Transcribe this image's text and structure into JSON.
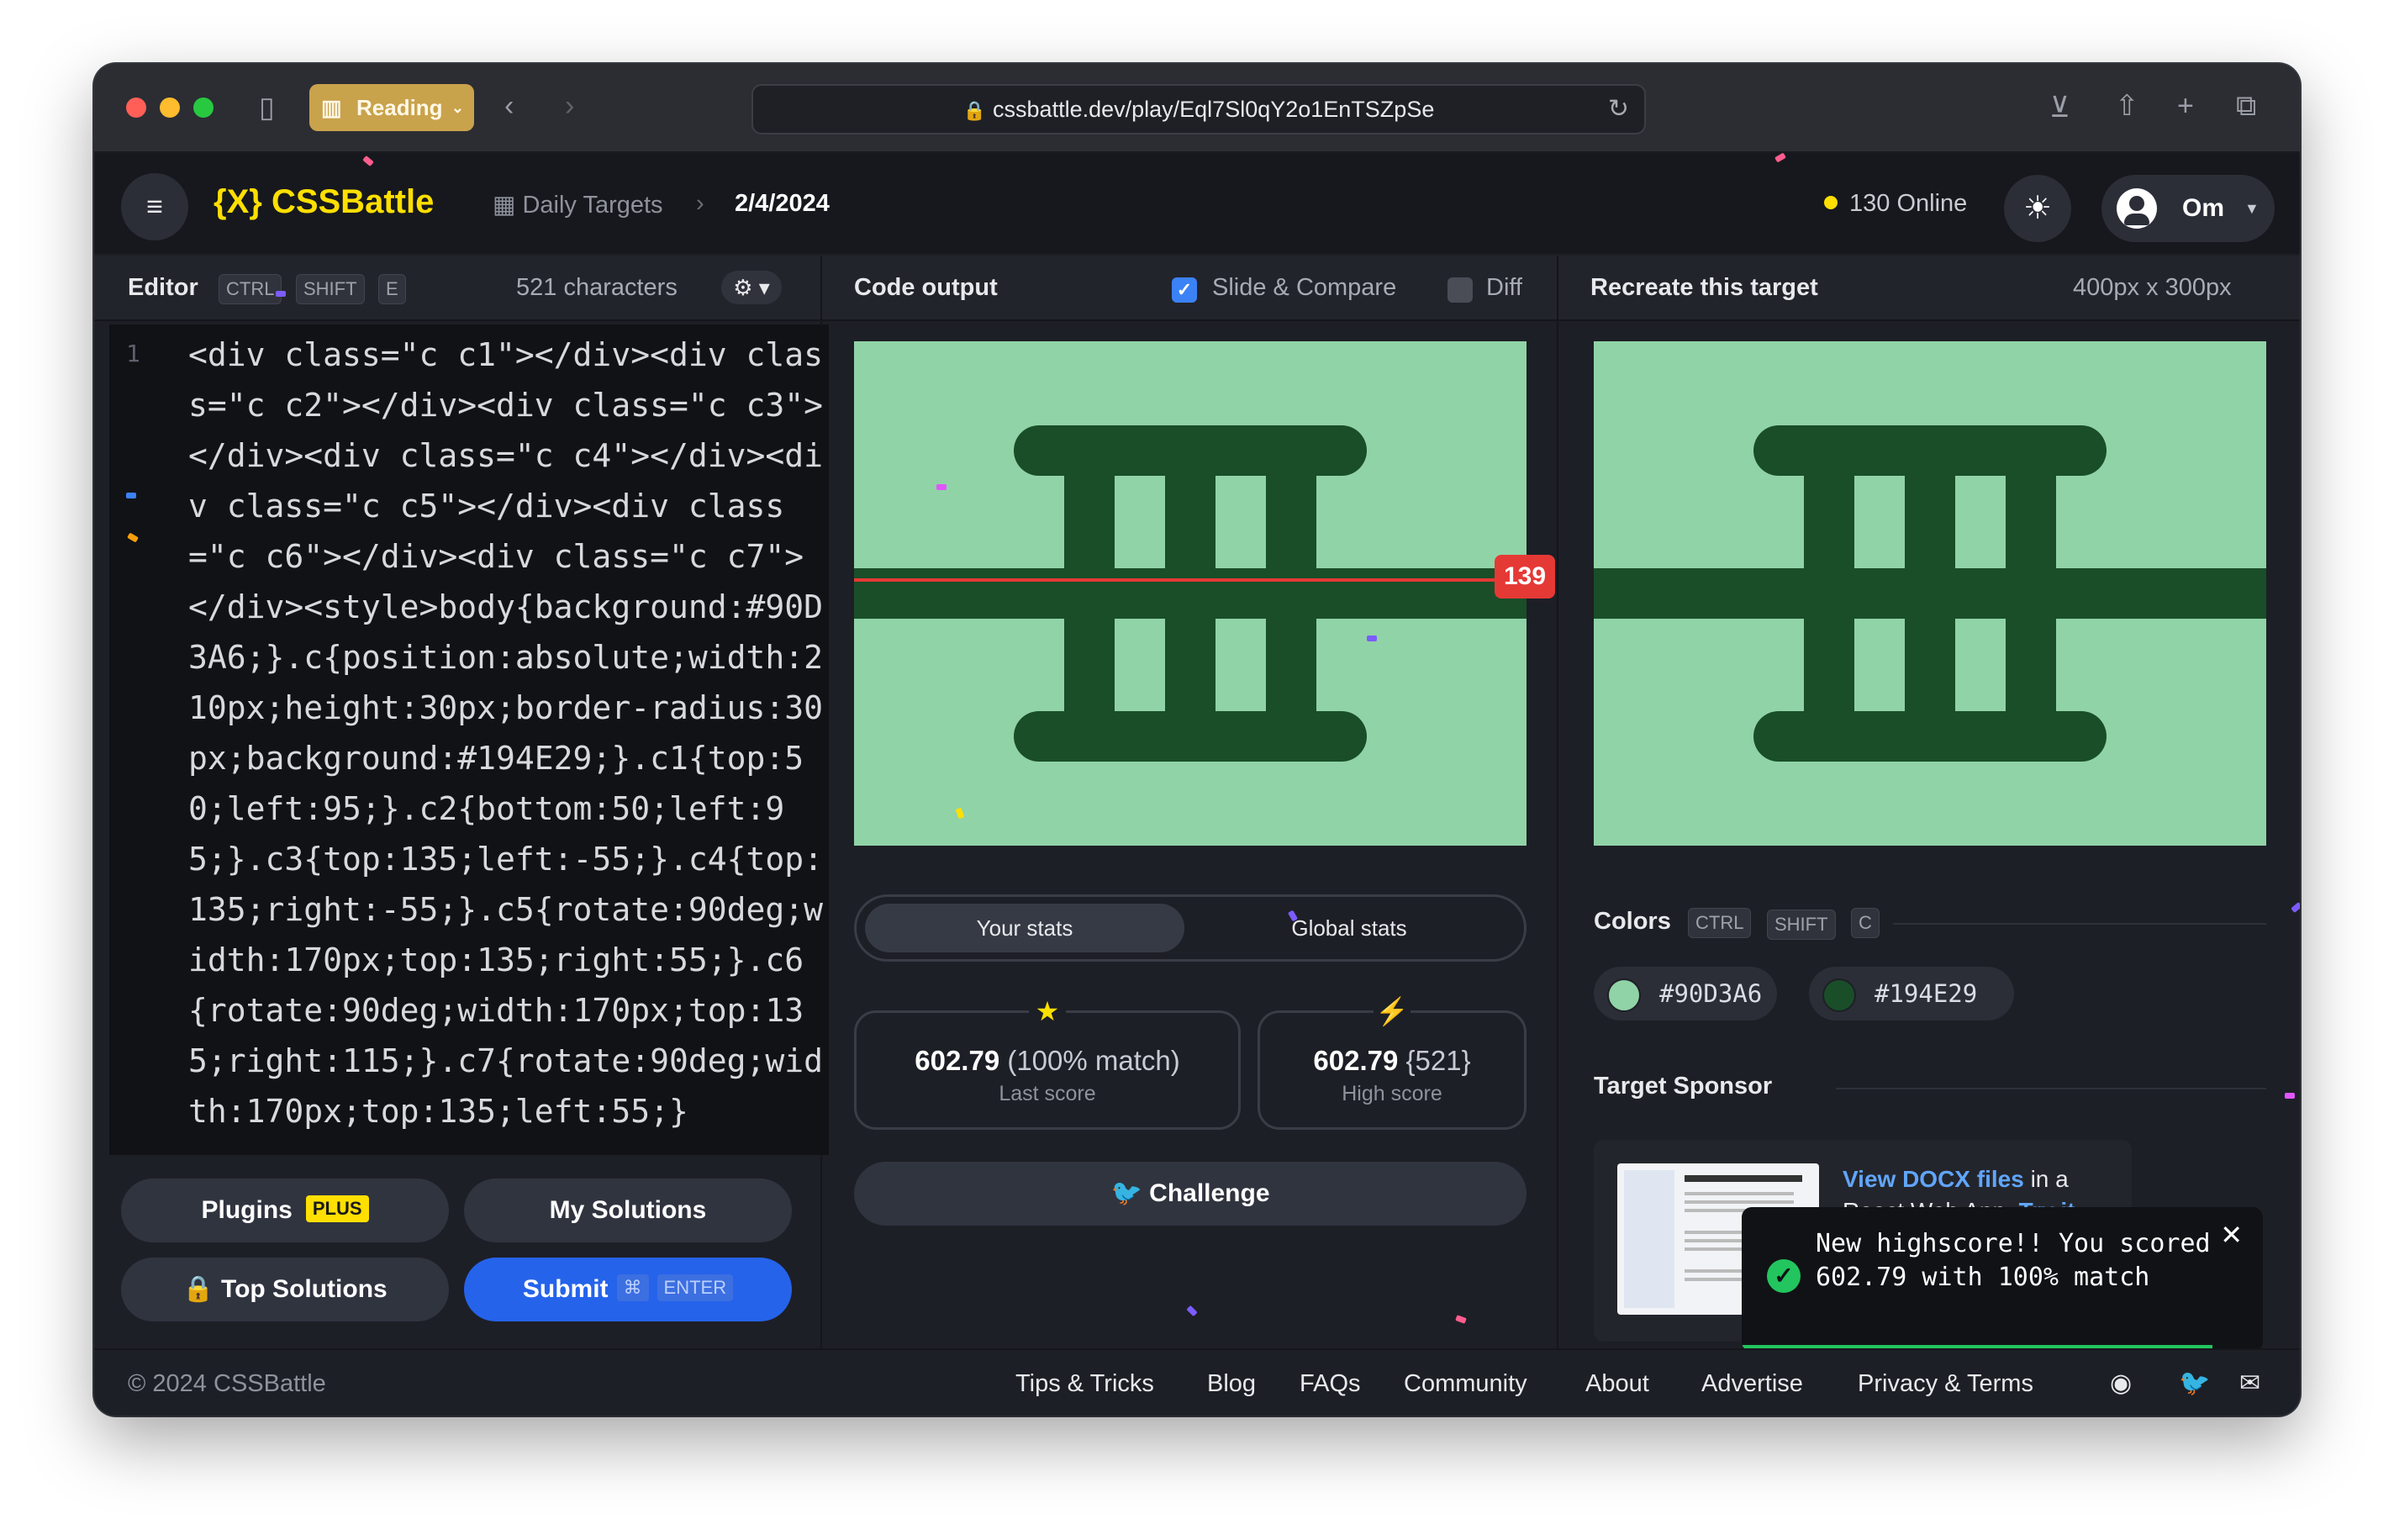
{
  "browser": {
    "reading_label": "Reading",
    "url": "cssbattle.dev/play/Eql7Sl0qY2o1EnTSZpSe"
  },
  "header": {
    "logo_mark": "{X}",
    "logo_text": "CSSBattle",
    "breadcrumb_daily": "Daily Targets",
    "breadcrumb_sep": "›",
    "breadcrumb_date": "2/4/2024",
    "online_text": "130 Online",
    "user_name": "Om"
  },
  "editor": {
    "title": "Editor",
    "shortcut": [
      "CTRL",
      "SHIFT",
      "E"
    ],
    "char_count": "521 characters",
    "line_number": "1",
    "code": "<div class=\"c c1\"></div><div class=\"c c2\"></div><div class=\"c c3\"></div><div class=\"c c4\"></div><div class=\"c c5\"></div><div class=\"c c6\"></div><div class=\"c c7\"></div><style>body{background:#90D3A6;}.c{position:absolute;width:210px;height:30px;border-radius:30px;background:#194E29;}.c1{top:50;left:95;}.c2{bottom:50;left:95;}.c3{top:135;left:-55;}.c4{top:135;right:-55;}.c5{rotate:90deg;width:170px;top:135;right:55;}.c6{rotate:90deg;width:170px;top:135;right:115;}.c7{rotate:90deg;width:170px;top:135;left:55;}"
  },
  "buttons": {
    "plugins": "Plugins",
    "plugins_badge": "PLUS",
    "my_solutions": "My Solutions",
    "top_solutions": "Top Solutions",
    "submit": "Submit",
    "submit_keys": [
      "⌘",
      "ENTER"
    ]
  },
  "output": {
    "title": "Code output",
    "slide_compare": "Slide & Compare",
    "slide_compare_checked": true,
    "diff": "Diff",
    "diff_checked": false,
    "slider_value": "139"
  },
  "stats": {
    "tab_your": "Your stats",
    "tab_global": "Global stats",
    "last_score": "602.79",
    "last_match": "(100% match)",
    "last_label": "Last score",
    "high_score": "602.79",
    "high_chars": "{521}",
    "high_label": "High score",
    "challenge": "Challenge"
  },
  "target": {
    "title": "Recreate this target",
    "size": "400px x 300px",
    "colors_title": "Colors",
    "colors_shortcut": [
      "CTRL",
      "SHIFT",
      "C"
    ],
    "colors": [
      {
        "hex": "#90D3A6",
        "swatch": "#90D3A6"
      },
      {
        "hex": "#194E29",
        "swatch": "#194E29"
      }
    ],
    "sponsor_title": "Target Sponsor",
    "sponsor_link": "View DOCX files",
    "sponsor_rest": " in a",
    "sponsor_line2": "React Web App.",
    "sponsor_try": "Try it"
  },
  "toast": {
    "message": "New highscore!! You scored 602.79 with 100% match"
  },
  "footer": {
    "copyright": "© 2024 CSSBattle",
    "links": [
      "Tips & Tricks",
      "Blog",
      "FAQs",
      "Community",
      "About",
      "Advertise",
      "Privacy & Terms"
    ]
  },
  "colors": {
    "target_bg": "#90d3a6",
    "target_fg": "#194e29",
    "accent": "#ffdf00",
    "submit": "#2563eb"
  }
}
